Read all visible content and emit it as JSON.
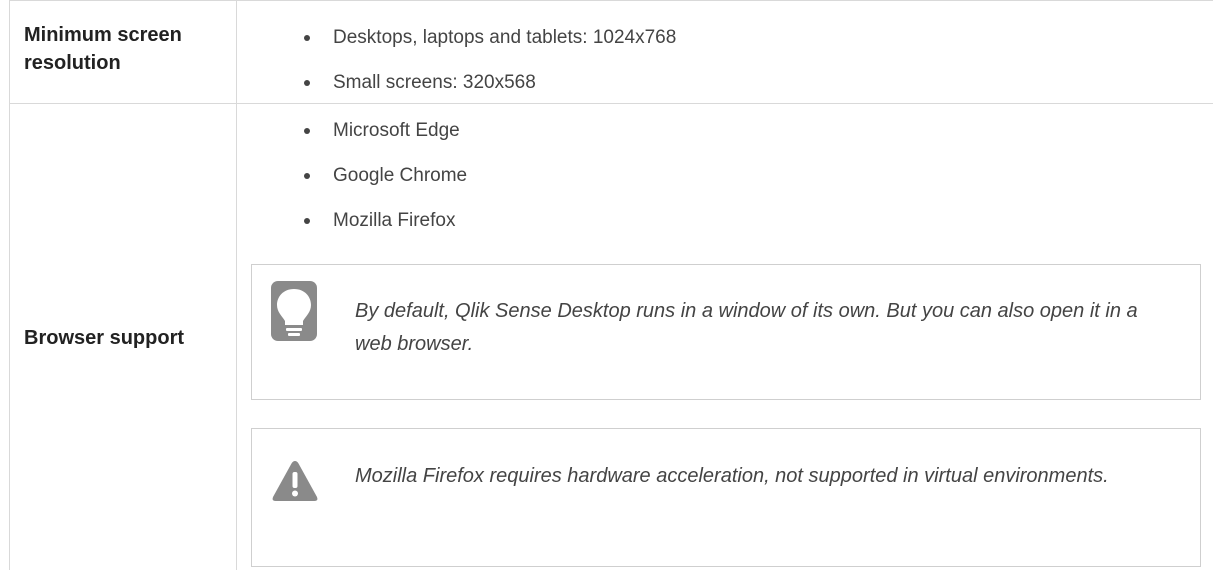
{
  "rows": [
    {
      "label": "Minimum screen resolution",
      "label_lines": [
        "Minimum screen",
        "resolution"
      ],
      "items": [
        "Desktops, laptops and tablets: 1024x768",
        "Small screens: 320x568"
      ]
    },
    {
      "label": "Browser support",
      "items": [
        "Microsoft Edge",
        "Google Chrome",
        "Mozilla Firefox"
      ],
      "tip": {
        "icon": "lightbulb-icon",
        "text": "By default, Qlik Sense Desktop runs in a window of its own. But you can also open it in a web browser."
      },
      "warning": {
        "icon": "warning-icon",
        "text": "Mozilla Firefox requires hardware acceleration, not supported in virtual environments."
      }
    }
  ],
  "colors": {
    "border": "#d9d9d9",
    "text": "#444444",
    "icon": "#8a8a8a"
  }
}
